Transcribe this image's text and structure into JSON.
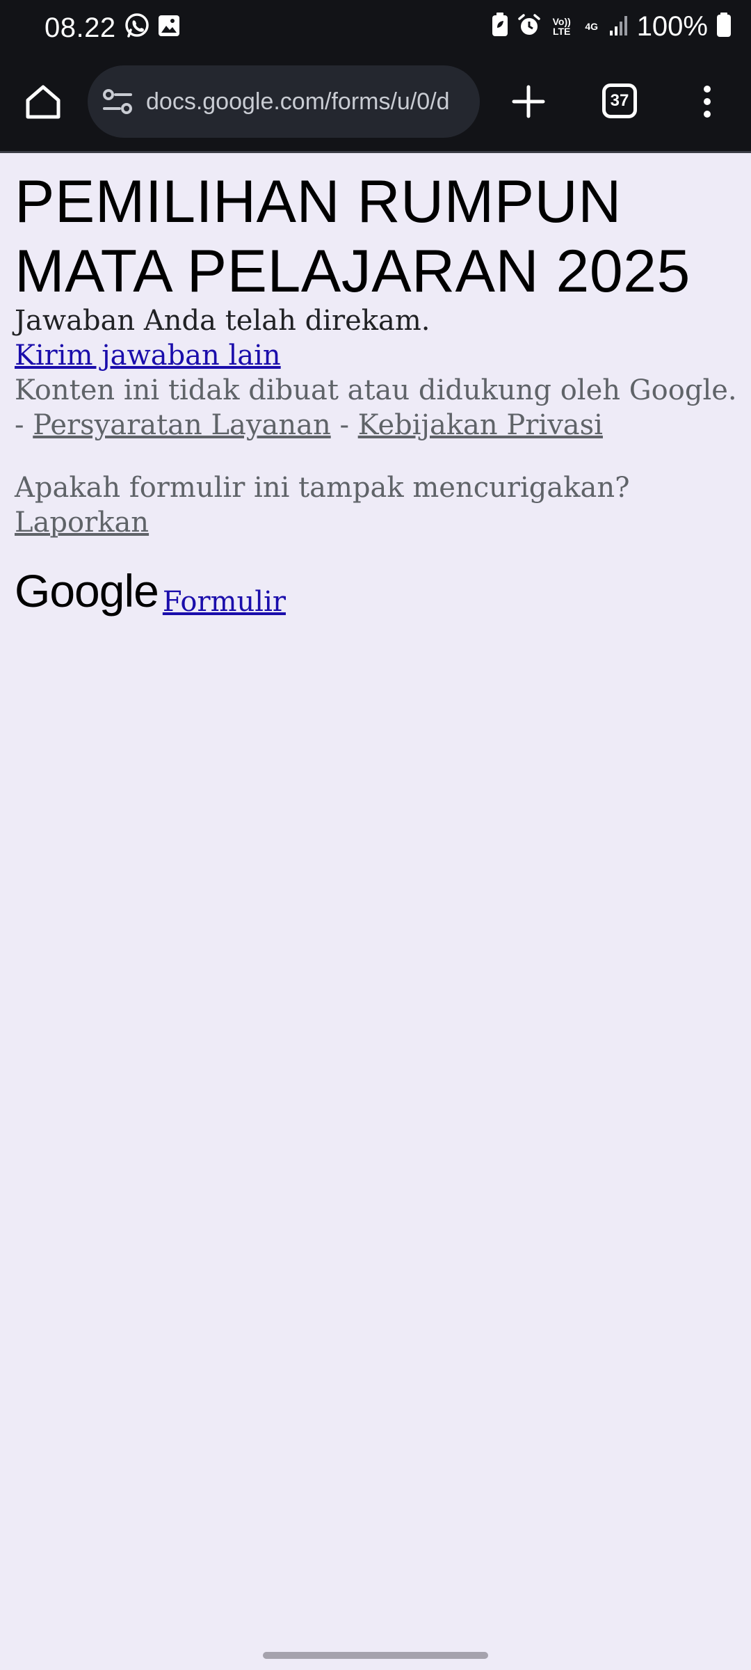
{
  "status_bar": {
    "time": "08.22",
    "battery_percent": "100%",
    "signal_labels": [
      "Vo)) LTE",
      "4G"
    ],
    "left_icons": [
      "whatsapp-icon",
      "gallery-icon"
    ],
    "right_icons": [
      "battery-saver-icon",
      "alarm-icon",
      "volte-icon",
      "4g-icon",
      "signal-icon",
      "battery-icon"
    ]
  },
  "browser": {
    "url": "docs.google.com/forms/u/0/d",
    "tab_count": "37"
  },
  "page": {
    "title": "PEMILIHAN RUMPUN MATA PELAJARAN 2025",
    "confirmation": "Jawaban Anda telah direkam.",
    "submit_another": "Kirim jawaban lain",
    "disclaimer": "Konten ini tidak dibuat atau didukung oleh Google.",
    "dash": "-",
    "terms": "Persyaratan Layanan",
    "privacy": "Kebijakan Privasi",
    "report_question": "Apakah formulir ini tampak mencurigakan?",
    "report_link": "Laporkan",
    "brand_logo": "Google",
    "brand_link": "Formulir"
  },
  "colors": {
    "page_background": "#eeebf7",
    "browser_chrome": "#121317",
    "link_blue": "#1a0dab",
    "secondary_text": "#5f6368"
  }
}
